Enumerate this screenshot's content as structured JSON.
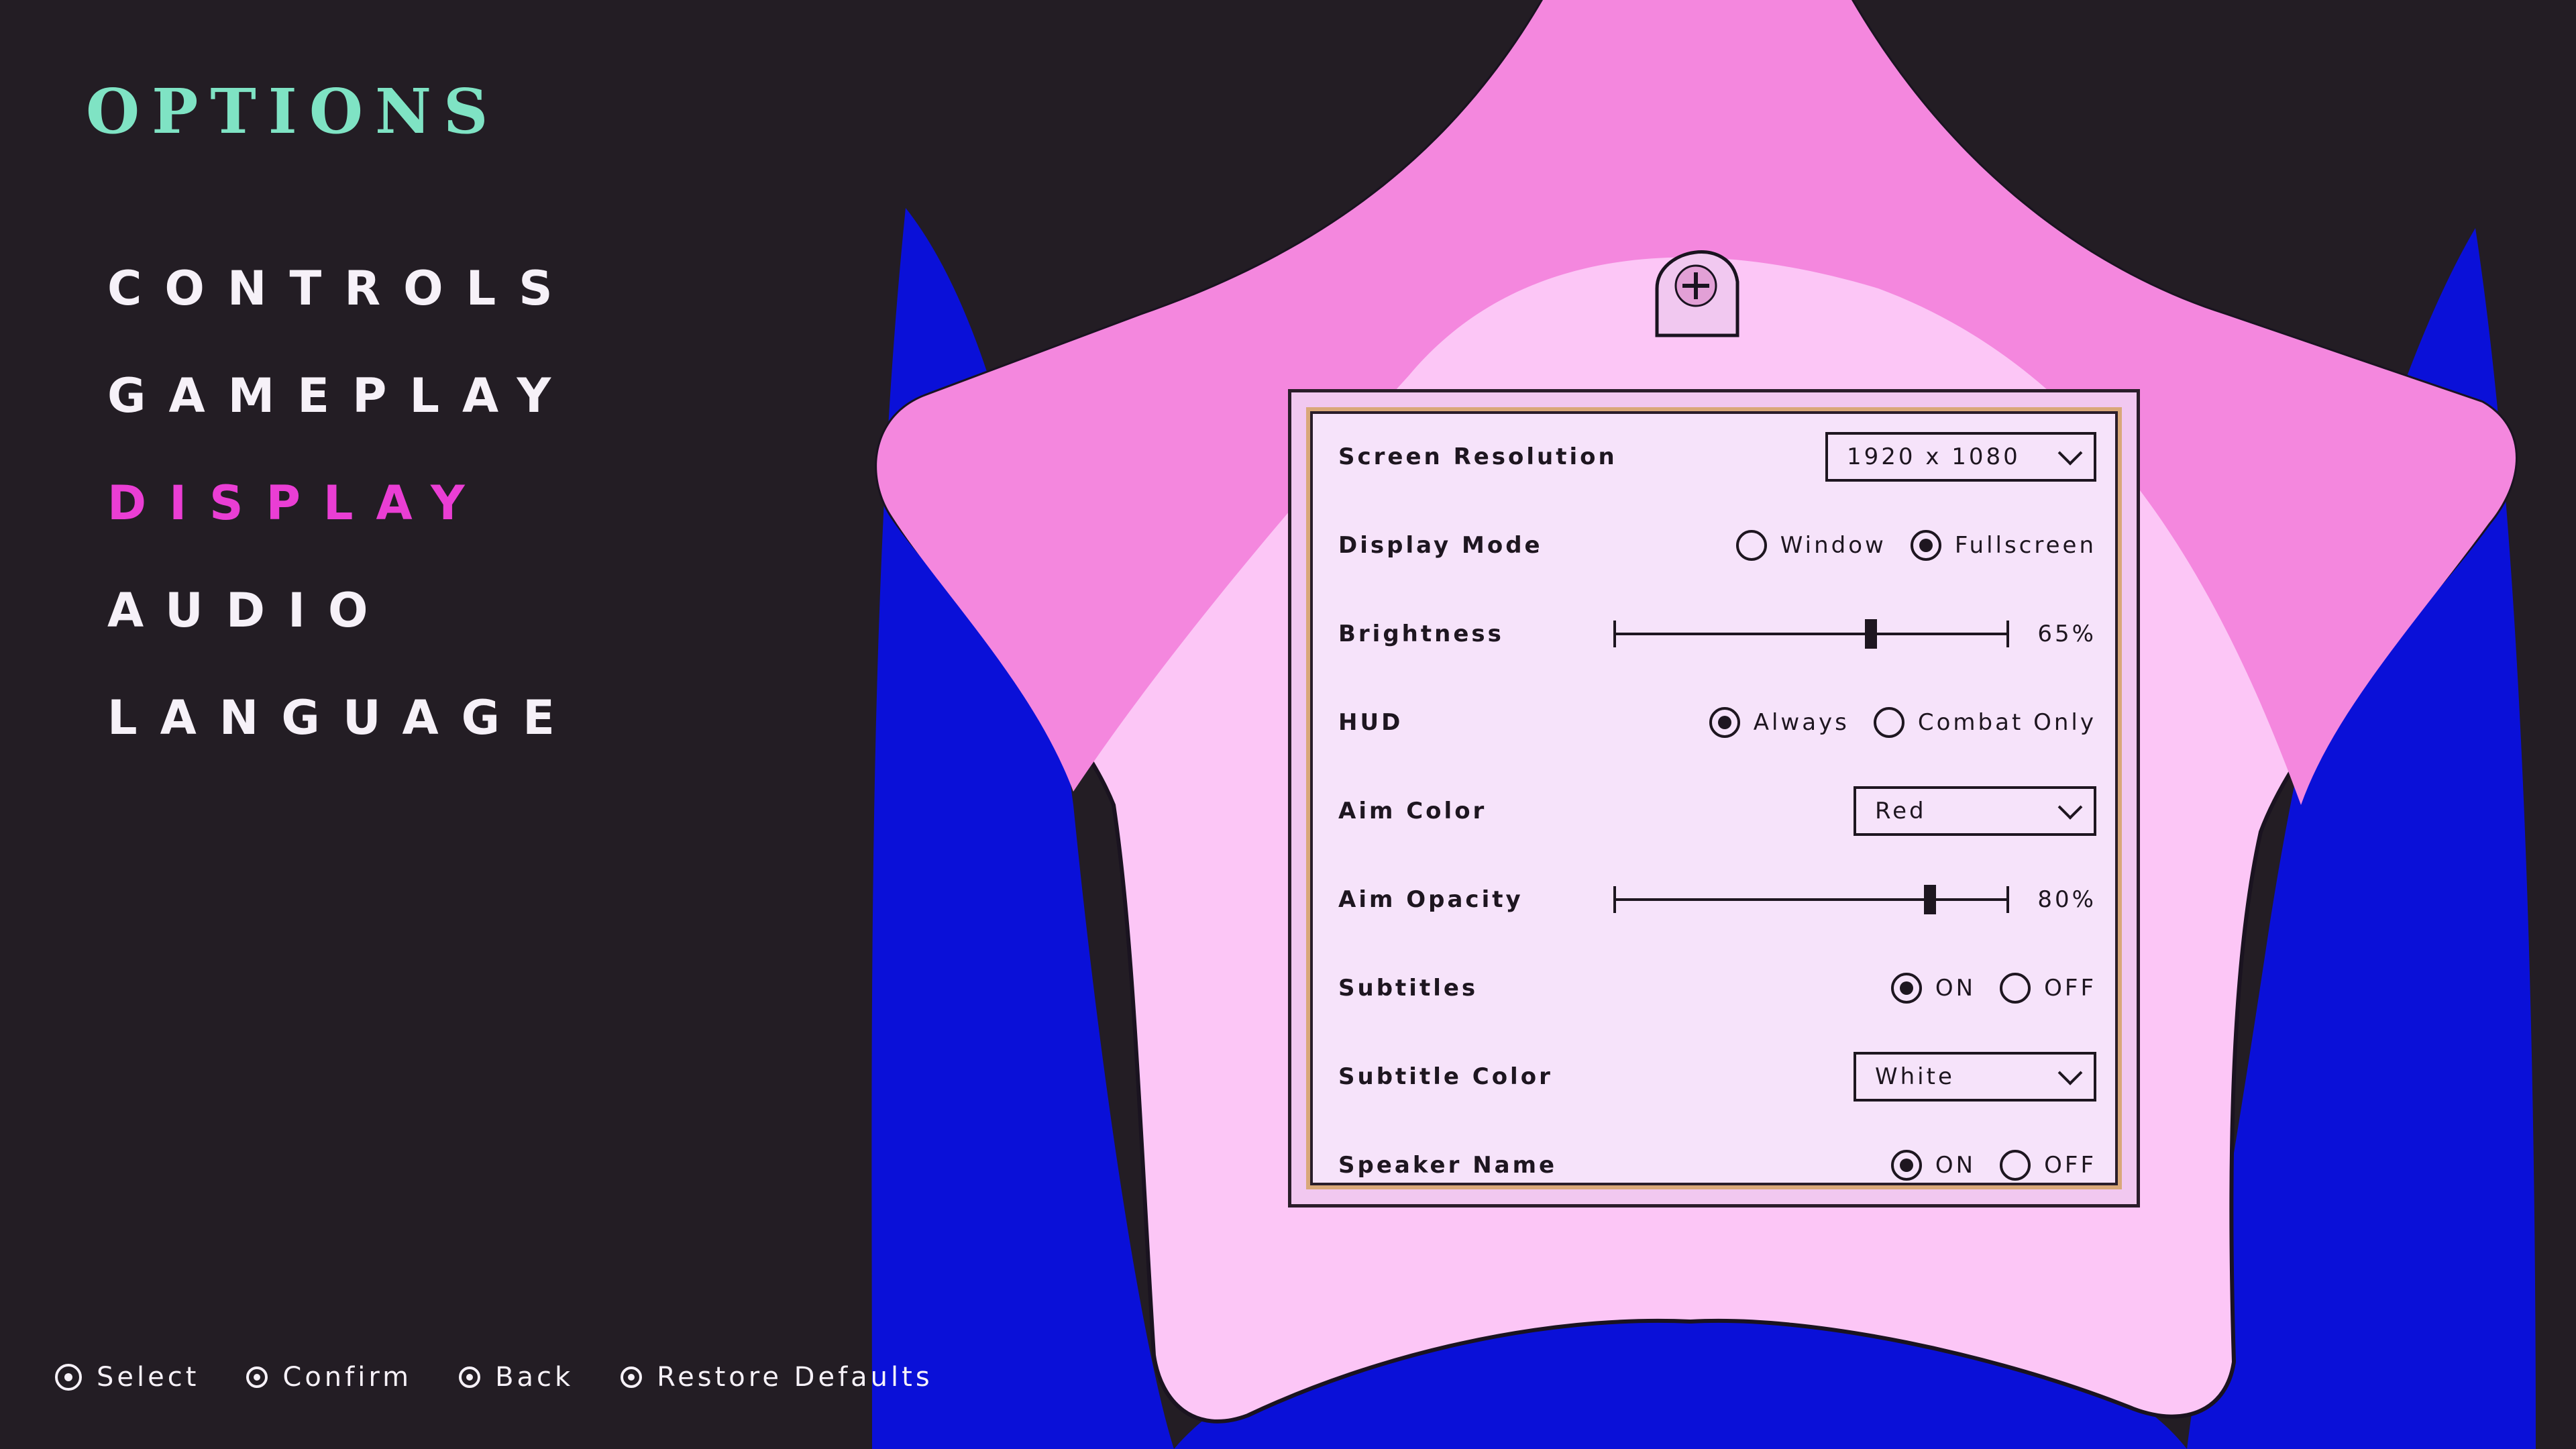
{
  "title": "OPTIONS",
  "menu": [
    {
      "label": "CONTROLS",
      "active": false
    },
    {
      "label": "GAMEPLAY",
      "active": false
    },
    {
      "label": "DISPLAY",
      "active": true
    },
    {
      "label": "AUDIO",
      "active": false
    },
    {
      "label": "LANGUAGE",
      "active": false
    }
  ],
  "options": {
    "screen_resolution": {
      "label": "Screen Resolution",
      "value": "1920 x 1080"
    },
    "display_mode": {
      "label": "Display Mode",
      "options": [
        "Window",
        "Fullscreen"
      ],
      "selected": 1
    },
    "brightness": {
      "label": "Brightness",
      "value": 65,
      "value_label": "65%"
    },
    "hud": {
      "label": "HUD",
      "options": [
        "Always",
        "Combat Only"
      ],
      "selected": 0
    },
    "aim_color": {
      "label": "Aim Color",
      "value": "Red"
    },
    "aim_opacity": {
      "label": "Aim Opacity",
      "value": 80,
      "value_label": "80%"
    },
    "subtitles": {
      "label": "Subtitles",
      "options": [
        "ON",
        "OFF"
      ],
      "selected": 0
    },
    "subtitle_color": {
      "label": "Subtitle Color",
      "value": "White"
    },
    "speaker_name": {
      "label": "Speaker Name",
      "options": [
        "ON",
        "OFF"
      ],
      "selected": 0
    }
  },
  "hints": [
    {
      "icon": "left-stick-icon",
      "label": "Select"
    },
    {
      "icon": "circle-button-icon",
      "label": "Confirm"
    },
    {
      "icon": "cross-button-icon",
      "label": "Back"
    },
    {
      "icon": "square-button-icon",
      "label": "Restore Defaults"
    }
  ],
  "colors": {
    "background": "#231d24",
    "title": "#7fe3c4",
    "menu_active": "#ea3ed4",
    "star_pink": "#f487de",
    "star_light": "#fcc6f6",
    "blue": "#0a10d8",
    "panel": "#f6e3fa"
  }
}
